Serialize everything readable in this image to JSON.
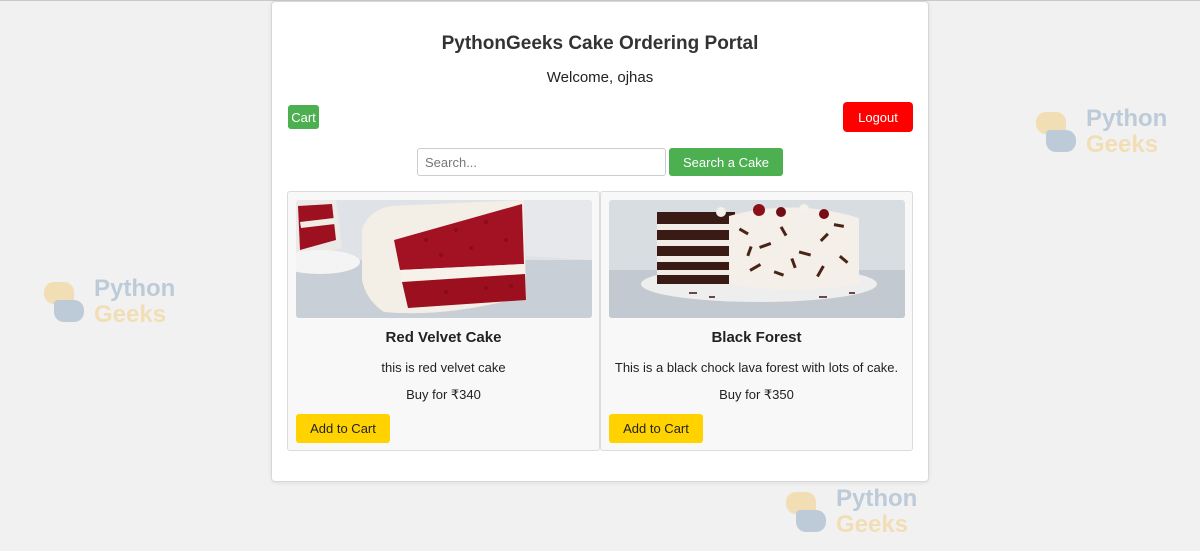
{
  "portal": {
    "title": "PythonGeeks Cake Ordering Portal",
    "welcome": "Welcome, ojhas"
  },
  "toolbar": {
    "cart_label": "Cart",
    "logout_label": "Logout"
  },
  "search": {
    "value": "",
    "placeholder": "Search...",
    "button_label": "Search a Cake"
  },
  "cakes": [
    {
      "name": "Red Velvet Cake",
      "description": "this is red velvet cake",
      "price": "Buy for ₹340",
      "button_label": "Add to Cart"
    },
    {
      "name": "Black Forest",
      "description": "This is a black chock lava forest with lots of cake.",
      "price": "Buy for ₹350",
      "button_label": "Add to Cart"
    }
  ],
  "watermark": {
    "line1": "Python",
    "line2": "Geeks"
  },
  "colors": {
    "background": "#f1f1f1",
    "primary_green": "#4caf50",
    "logout_red": "#ff0000",
    "add_to_cart_yellow": "#ffd200",
    "watermark_blue": "#3a6b9a",
    "watermark_yellow": "#f2b01e"
  }
}
